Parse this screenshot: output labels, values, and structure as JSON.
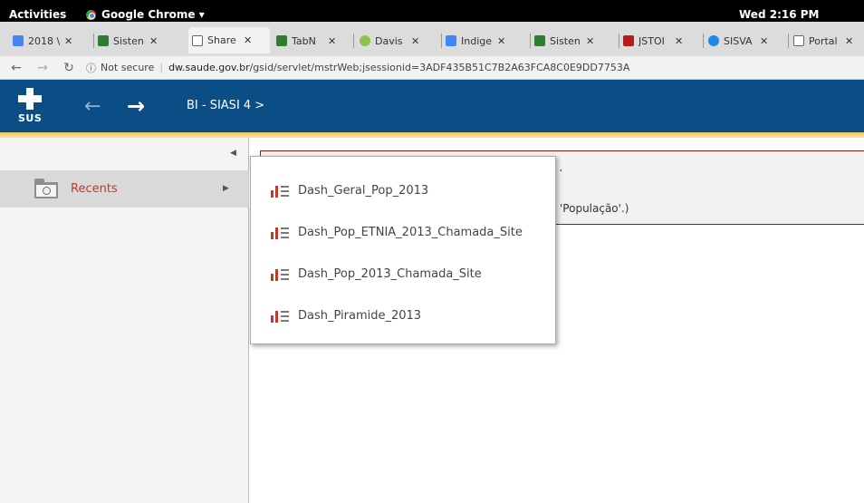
{
  "system_bar": {
    "activities": "Activities",
    "app_name": "Google Chrome ▾",
    "clock": "Wed 2:16 PM"
  },
  "tabs": [
    {
      "label": "2018 \\",
      "icon": "docs-icon",
      "color": "#4285f4"
    },
    {
      "label": "Sisten",
      "icon": "datasus-icon",
      "color": "#2e7d32"
    },
    {
      "label": "Share",
      "icon": "page-icon",
      "color": "#888888"
    },
    {
      "label": "TabN",
      "icon": "datasus-icon",
      "color": "#2e7d32"
    },
    {
      "label": "Davis",
      "icon": "asterisk-icon",
      "color": "#8bc34a"
    },
    {
      "label": "Indige",
      "icon": "docs-icon",
      "color": "#4285f4"
    },
    {
      "label": "Sisten",
      "icon": "datasus-icon",
      "color": "#2e7d32"
    },
    {
      "label": "JSTOI",
      "icon": "jstor-icon",
      "color": "#b71c1c"
    },
    {
      "label": "SISVA",
      "icon": "sisvan-icon",
      "color": "#1e88e5"
    },
    {
      "label": "Portal",
      "icon": "page-icon",
      "color": "#888888"
    }
  ],
  "address": {
    "security": "Not secure",
    "domain": "dw.saude.gov.br",
    "path": "/gsid/servlet/mstrWeb;jsessionid=3ADF435B51C7B2A63FCA8C0E9DD7753A"
  },
  "header": {
    "logo_text": "SUS",
    "breadcrumb": "BI - SIASI 4  >"
  },
  "sidebar": {
    "recents_label": "Recents"
  },
  "panel": {
    "title_fragment": ".",
    "text_fragment": "'População'.)"
  },
  "dropdown": {
    "items": [
      {
        "label": "Dash_Geral_Pop_2013"
      },
      {
        "label": "Dash_Pop_ETNIA_2013_Chamada_Site"
      },
      {
        "label": "Dash_Pop_2013_Chamada_Site"
      },
      {
        "label": "Dash_Piramide_2013"
      }
    ]
  },
  "colors": {
    "header_bg": "#0b4e86",
    "accent_red": "#c0392b",
    "gold_stripe": "#f0c95b"
  }
}
